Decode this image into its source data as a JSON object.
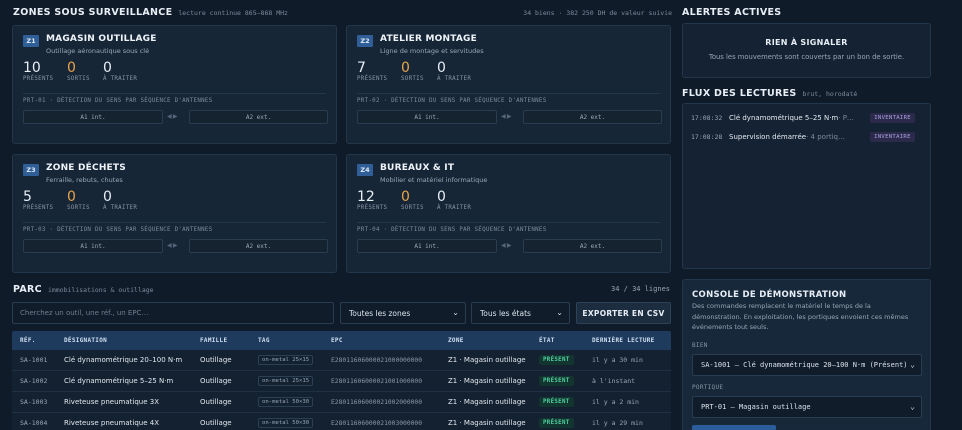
{
  "zones_section": {
    "title": "ZONES SOUS SURVEILLANCE",
    "subtitle": "lecture continue 865–868 MHz",
    "summary": "34 biens · 382 250 DH de valeur suivie"
  },
  "zones": [
    {
      "badge": "Z1",
      "title": "MAGASIN OUTILLAGE",
      "desc": "Outillage aéronautique sous clé",
      "present": "10",
      "sortis": "0",
      "traiter": "0",
      "present_label": "PRÉSENTS",
      "sortis_label": "SORTIS",
      "traiter_label": "À TRAITER",
      "portal": "PRT-01 · DÉTECTION DU SENS PAR SÉQUENCE D'ANTENNES",
      "a1": "A1 int.",
      "a2": "A2 ext."
    },
    {
      "badge": "Z2",
      "title": "ATELIER MONTAGE",
      "desc": "Ligne de montage et servitudes",
      "present": "7",
      "sortis": "0",
      "traiter": "0",
      "present_label": "PRÉSENTS",
      "sortis_label": "SORTIS",
      "traiter_label": "À TRAITER",
      "portal": "PRT-02 · DÉTECTION DU SENS PAR SÉQUENCE D'ANTENNES",
      "a1": "A1 int.",
      "a2": "A2 ext."
    },
    {
      "badge": "Z3",
      "title": "ZONE DÉCHETS",
      "desc": "Ferraille, rebuts, chutes",
      "present": "5",
      "sortis": "0",
      "traiter": "0",
      "present_label": "PRÉSENTS",
      "sortis_label": "SORTIS",
      "traiter_label": "À TRAITER",
      "portal": "PRT-03 · DÉTECTION DU SENS PAR SÉQUENCE D'ANTENNES",
      "a1": "A1 int.",
      "a2": "A2 ext."
    },
    {
      "badge": "Z4",
      "title": "BUREAUX & IT",
      "desc": "Mobilier et matériel informatique",
      "present": "12",
      "sortis": "0",
      "traiter": "0",
      "present_label": "PRÉSENTS",
      "sortis_label": "SORTIS",
      "traiter_label": "À TRAITER",
      "portal": "PRT-04 · DÉTECTION DU SENS PAR SÉQUENCE D'ANTENNES",
      "a1": "A1 int.",
      "a2": "A2 ext."
    }
  ],
  "alerts": {
    "title": "ALERTES ACTIVES",
    "empty_title": "RIEN À SIGNALER",
    "empty_text": "Tous les mouvements sont couverts par un bon de sortie."
  },
  "feed": {
    "title": "FLUX DES LECTURES",
    "subtitle": "brut, horodaté",
    "rows": [
      {
        "time": "17:08:32",
        "text": "Clé dynamométrique 5–25 N·m",
        "extra": " · P…",
        "tag": "INVENTAIRE"
      },
      {
        "time": "17:08:28",
        "text": "Supervision démarrée",
        "extra": " · 4 portiq…",
        "tag": "INVENTAIRE"
      }
    ]
  },
  "parc": {
    "title": "PARC",
    "subtitle": "immobilisations & outillage",
    "count": "34 / 34 lignes",
    "search_placeholder": "Cherchez un outil, une réf., un EPC…",
    "zone_filter": "Toutes les zones",
    "state_filter": "Tous les états",
    "export_label": "EXPORTER EN CSV",
    "columns": [
      "RÉF.",
      "DÉSIGNATION",
      "FAMILLE",
      "TAG",
      "EPC",
      "ZONE",
      "ÉTAT",
      "DERNIÈRE LECTURE"
    ],
    "rows": [
      {
        "ref": "SA-1001",
        "designation": "Clé dynamométrique 20–100 N·m",
        "famille": "Outillage",
        "tag": "on-metal 25×15",
        "epc": "E28011606000021000000000",
        "zone": "Z1 · Magasin outillage",
        "etat": "PRÉSENT",
        "last": "il y a 30 min"
      },
      {
        "ref": "SA-1002",
        "designation": "Clé dynamométrique 5–25 N·m",
        "famille": "Outillage",
        "tag": "on-metal 25×15",
        "epc": "E28011606000021001000000",
        "zone": "Z1 · Magasin outillage",
        "etat": "PRÉSENT",
        "last": "à l'instant"
      },
      {
        "ref": "SA-1003",
        "designation": "Riveteuse pneumatique 3X",
        "famille": "Outillage",
        "tag": "on-metal 50×30",
        "epc": "E28011606000021002000000",
        "zone": "Z1 · Magasin outillage",
        "etat": "PRÉSENT",
        "last": "il y a 2 min"
      },
      {
        "ref": "SA-1004",
        "designation": "Riveteuse pneumatique 4X",
        "famille": "Outillage",
        "tag": "on-metal 50×30",
        "epc": "E28011606000021003000000",
        "zone": "Z1 · Magasin outillage",
        "etat": "PRÉSENT",
        "last": "il y a 29 min"
      }
    ]
  },
  "console": {
    "title": "CONSOLE DE DÉMONSTRATION",
    "desc": "Des commandes remplacent le matériel le temps de la démonstration. En exploitation, les portiques envoient ces mêmes événements tout seuls.",
    "bien_label": "BIEN",
    "bien_value": "SA-1001 — Clé dynamométrique 20–100 N·m (Présent)",
    "portique_label": "PORTIQUE",
    "portique_value": "PRT-01 — Magasin outillage"
  }
}
